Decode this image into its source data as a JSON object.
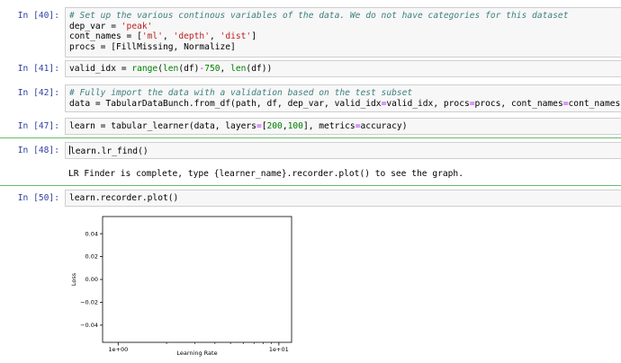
{
  "cells": [
    {
      "prompt": "In [40]:",
      "lines": [
        [
          {
            "t": "# Set up the various continous variables of the data. We do not have categories for this dataset",
            "c": "cm"
          }
        ],
        [
          {
            "t": "dep_var = "
          },
          {
            "t": "'peak'",
            "c": "st"
          }
        ],
        [
          {
            "t": "cont_names = ["
          },
          {
            "t": "'ml'",
            "c": "st"
          },
          {
            "t": ", "
          },
          {
            "t": "'depth'",
            "c": "st"
          },
          {
            "t": ", "
          },
          {
            "t": "'dist'",
            "c": "st"
          },
          {
            "t": "]"
          }
        ],
        [
          {
            "t": "procs = [FillMissing, Normalize]"
          }
        ]
      ]
    },
    {
      "prompt": "In [41]:",
      "lines": [
        [
          {
            "t": "valid_idx = "
          },
          {
            "t": "range",
            "c": "nm"
          },
          {
            "t": "("
          },
          {
            "t": "len",
            "c": "nm"
          },
          {
            "t": "(df)"
          },
          {
            "t": "-",
            "c": "op"
          },
          {
            "t": "750",
            "c": "nm"
          },
          {
            "t": ", "
          },
          {
            "t": "len",
            "c": "nm"
          },
          {
            "t": "(df))"
          }
        ]
      ]
    },
    {
      "prompt": "In [42]:",
      "lines": [
        [
          {
            "t": "# Fully import the data with a validation based on the test subset",
            "c": "cm"
          }
        ],
        [
          {
            "t": "data = TabularDataBunch.from_df(path, df, dep_var, valid_idx"
          },
          {
            "t": "=",
            "c": "op"
          },
          {
            "t": "valid_idx, procs"
          },
          {
            "t": "=",
            "c": "op"
          },
          {
            "t": "procs, cont_names"
          },
          {
            "t": "=",
            "c": "op"
          },
          {
            "t": "cont_names)"
          }
        ]
      ]
    },
    {
      "prompt": "In [47]:",
      "lines": [
        [
          {
            "t": "learn = tabular_learner(data, layers"
          },
          {
            "t": "=",
            "c": "op"
          },
          {
            "t": "["
          },
          {
            "t": "200",
            "c": "nm"
          },
          {
            "t": ","
          },
          {
            "t": "100",
            "c": "nm"
          },
          {
            "t": "], metrics"
          },
          {
            "t": "=",
            "c": "op"
          },
          {
            "t": "accuracy)"
          }
        ]
      ]
    },
    {
      "prompt": "In [48]:",
      "lines": [
        [
          {
            "t": "learn.lr_find()"
          }
        ]
      ],
      "output": "LR Finder is complete, type {learner_name}.recorder.plot() to see the graph."
    },
    {
      "prompt": "In [50]:",
      "lines": [
        [
          {
            "t": "learn.recorder.plot()"
          }
        ]
      ]
    }
  ],
  "chart_data": {
    "type": "line",
    "xlabel": "Learning Rate",
    "ylabel": "Loss",
    "xscale": "log",
    "xlim": [
      0.8,
      12
    ],
    "ylim": [
      -0.055,
      0.055
    ],
    "xticks": [
      {
        "v": 1,
        "label": "1e+00"
      },
      {
        "v": 10,
        "label": "1e+01"
      }
    ],
    "yticks": [
      {
        "v": 0.04,
        "label": "0.04"
      },
      {
        "v": 0.02,
        "label": "0.02"
      },
      {
        "v": 0.0,
        "label": "0.00"
      },
      {
        "v": -0.02,
        "label": "−0.02"
      },
      {
        "v": -0.04,
        "label": "−0.04"
      }
    ],
    "series": [],
    "grid": false
  }
}
